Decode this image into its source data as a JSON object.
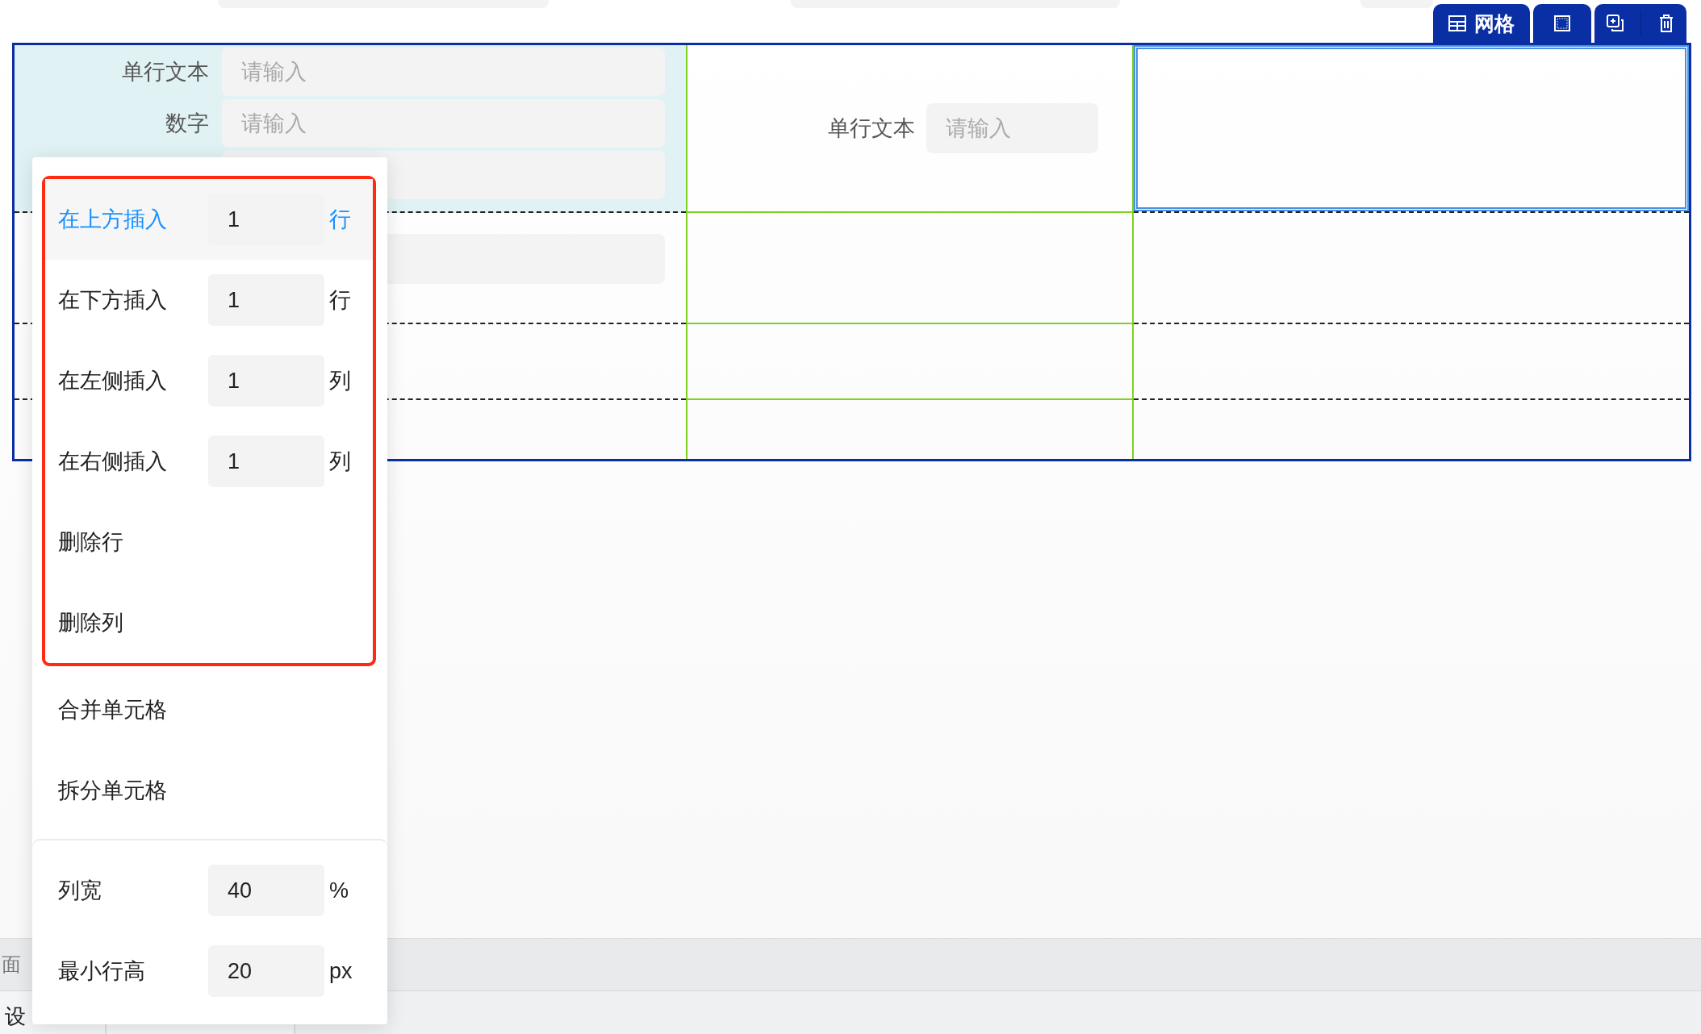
{
  "toolbar": {
    "title": "网格"
  },
  "grid": {
    "cells": [
      {
        "kind": "form",
        "selected": false,
        "fields": [
          {
            "label": "单行文本",
            "placeholder": "请输入"
          },
          {
            "label": "数字",
            "placeholder": "请输入"
          }
        ]
      },
      {
        "kind": "form",
        "selected": false,
        "fields": [
          {
            "label": "单行文本",
            "placeholder": "请输入"
          }
        ]
      },
      {
        "kind": "empty",
        "selected": true
      }
    ]
  },
  "context_menu": {
    "groups": [
      {
        "outlined": true,
        "separated": false,
        "items": [
          {
            "kind": "input",
            "label": "在上方插入",
            "value": "1",
            "unit": "行",
            "selected": true
          },
          {
            "kind": "input",
            "label": "在下方插入",
            "value": "1",
            "unit": "行",
            "selected": false
          },
          {
            "kind": "input",
            "label": "在左侧插入",
            "value": "1",
            "unit": "列",
            "selected": false
          },
          {
            "kind": "input",
            "label": "在右侧插入",
            "value": "1",
            "unit": "列",
            "selected": false
          },
          {
            "kind": "action",
            "label": "删除行",
            "selected": false
          },
          {
            "kind": "action",
            "label": "删除列",
            "selected": false
          }
        ]
      },
      {
        "outlined": false,
        "separated": false,
        "items": [
          {
            "kind": "action",
            "label": "合并单元格",
            "selected": false
          },
          {
            "kind": "action",
            "label": "拆分单元格",
            "selected": false
          }
        ]
      },
      {
        "outlined": false,
        "separated": true,
        "items": [
          {
            "kind": "input",
            "label": "列宽",
            "value": "40",
            "unit": "%",
            "selected": false
          },
          {
            "kind": "input",
            "label": "最小行高",
            "value": "20",
            "unit": "px",
            "selected": false
          }
        ]
      }
    ]
  },
  "bottom_bar": {
    "page_tab": "面",
    "log_tabs": [
      {
        "label": "设"
      }
    ]
  }
}
